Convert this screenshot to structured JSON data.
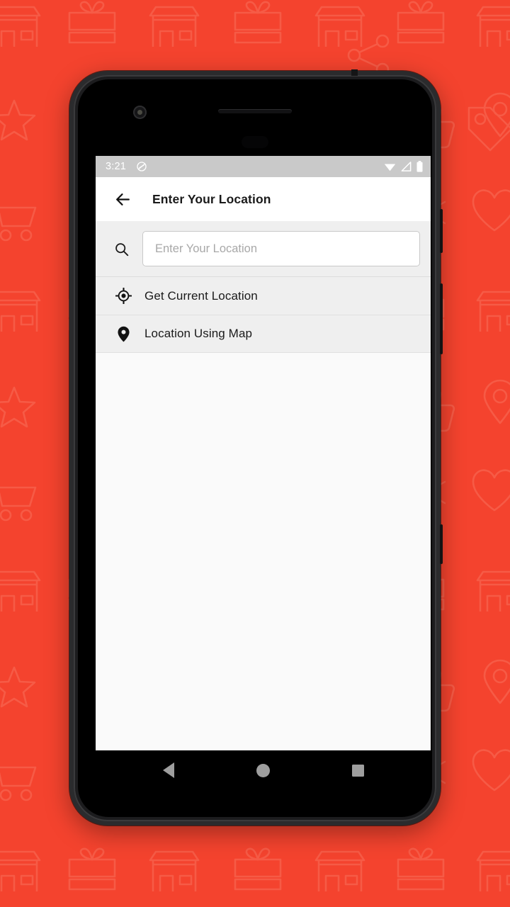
{
  "background": {
    "color": "#F4432E",
    "pattern_stroke": "#F8705C",
    "pattern_icons": [
      "shop-icon",
      "gift-icon",
      "star-icon",
      "map-pin-icon",
      "thumbs-up-icon",
      "shopping-cart-icon",
      "heart-icon",
      "snowflake-icon",
      "share-icon",
      "tag-icon"
    ]
  },
  "device": {
    "frame_color": "#2b2b2d",
    "sensors": [
      "front-camera",
      "earpiece-speaker",
      "proximity-sensor"
    ]
  },
  "status_bar": {
    "time": "3:21",
    "background": "#C9C9C9",
    "foreground": "#FFFFFF",
    "left_icons": [
      "location-off-icon"
    ],
    "right_icons": [
      "wifi-icon",
      "cellular-signal-icon",
      "battery-icon"
    ]
  },
  "app_bar": {
    "back_icon": "arrow-left-icon",
    "title": "Enter Your Location",
    "background": "#FFFFFF"
  },
  "search": {
    "icon": "search-icon",
    "placeholder": "Enter Your Location",
    "value": "",
    "background": "#EFEFEF"
  },
  "options": [
    {
      "icon": "gps-crosshair-icon",
      "label": "Get Current Location"
    },
    {
      "icon": "map-pin-icon",
      "label": "Location Using Map"
    }
  ],
  "nav_bar": {
    "background": "#000000",
    "glyph_color": "#9E9E9E",
    "keys": [
      {
        "name": "back",
        "icon": "triangle-back-icon"
      },
      {
        "name": "home",
        "icon": "circle-home-icon"
      },
      {
        "name": "recents",
        "icon": "square-recents-icon"
      }
    ]
  }
}
